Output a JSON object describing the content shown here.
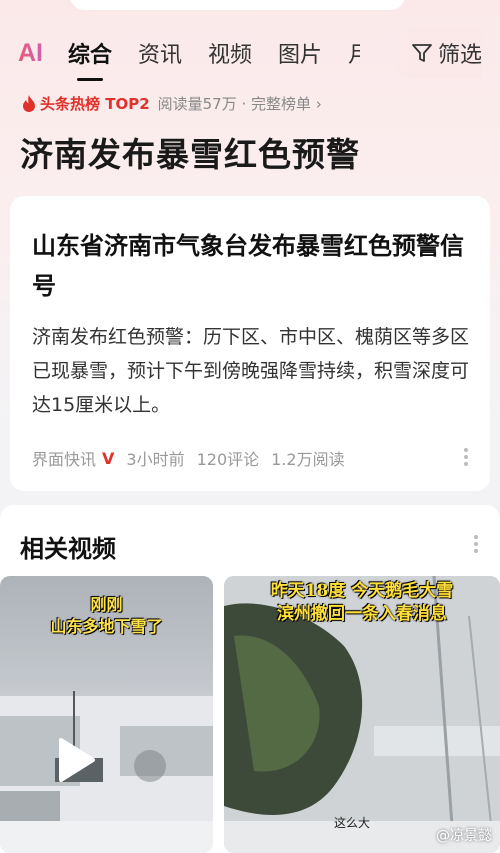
{
  "tabs": {
    "logo": "AI",
    "items": [
      "综合",
      "资讯",
      "视频",
      "图片",
      "月"
    ],
    "filter_label": "筛选"
  },
  "hot": {
    "label": "头条热榜 TOP2",
    "meta": "阅读量57万 · 完整榜单 ›"
  },
  "page_title": "济南发布暴雪红色预警",
  "news_card": {
    "title": "山东省济南市气象台发布暴雪红色预警信号",
    "body": "济南发布红色预警：历下区、市中区、槐荫区等多区已现暴雪，预计下午到傍晚强降雪持续，积雪深度可达15厘米以上。",
    "source": "界面快讯",
    "verified_badge": "V",
    "time": "3小时前",
    "comments": "120评论",
    "reads": "1.2万阅读"
  },
  "related_videos": {
    "title": "相关视频",
    "items": [
      {
        "caption_line1": "刚刚",
        "caption_line2": "山东多地下雪了"
      },
      {
        "caption_line1": "昨天18度 今天鹅毛大雪",
        "caption_line2": "滨州撤回一条入春消息",
        "inner_text": "这么大",
        "watermark": "@凉景懿"
      }
    ]
  },
  "colors": {
    "accent_red": "#e0312b",
    "caption_yellow": "#ffe34d"
  }
}
